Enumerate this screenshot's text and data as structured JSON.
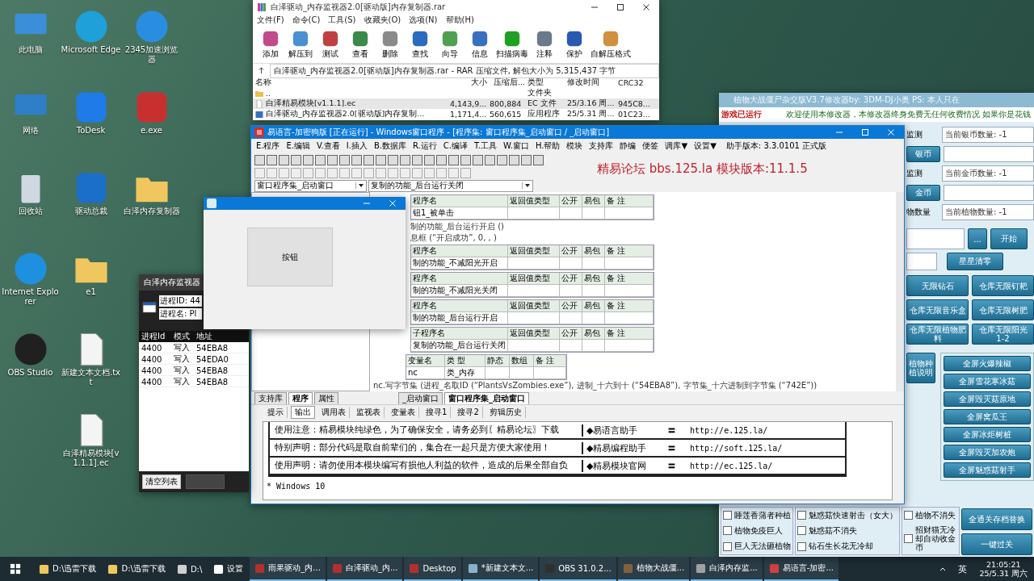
{
  "desktop": {
    "columns": [
      [
        {
          "label": "此电脑",
          "kind": "monitor",
          "color": "#3a8fd8"
        },
        {
          "label": "网络",
          "kind": "monitor",
          "color": "#2f7fc8"
        },
        {
          "label": "回收站",
          "kind": "bin",
          "color": "#cfd8e0"
        },
        {
          "label": "Internet Explorer",
          "kind": "circle",
          "color": "#1e90e0"
        },
        {
          "label": "OBS Studio",
          "kind": "circle",
          "color": "#202020"
        }
      ],
      [
        {
          "label": "Microsoft Edge",
          "kind": "circle",
          "color": "#1fa0d8"
        },
        {
          "label": "ToDesk",
          "kind": "app",
          "color": "#1f7be8"
        },
        {
          "label": "驱动总裁",
          "kind": "app",
          "color": "#1a6fc8"
        },
        {
          "label": "e1",
          "kind": "folder",
          "color": "#f0c75e"
        },
        {
          "label": "新建文本文档.txt",
          "kind": "doc",
          "color": "#f4f4f4"
        },
        {
          "label": "白泽精易模块[v1.1.1].ec",
          "kind": "doc",
          "color": "#f4f4f4"
        }
      ],
      [
        {
          "label": "2345加速浏览器",
          "kind": "circle",
          "color": "#2a8ee0"
        },
        {
          "label": "e.exe",
          "kind": "app",
          "color": "#c83030"
        },
        {
          "label": "白泽内存复制器",
          "kind": "folder",
          "color": "#f0c75e"
        }
      ]
    ]
  },
  "rar": {
    "title": "白泽驱动_内存监视器2.0[驱动版]内存复制器.rar",
    "menu": [
      "文件(F)",
      "命令(C)",
      "工具(S)",
      "收藏夹(O)",
      "选项(N)",
      "帮助(H)"
    ],
    "tools": [
      {
        "label": "添加",
        "color": "#c04a8a"
      },
      {
        "label": "解压到",
        "color": "#4a90d0"
      },
      {
        "label": "测试",
        "color": "#c04040"
      },
      {
        "label": "查看",
        "color": "#3a8a4a"
      },
      {
        "label": "删除",
        "color": "#8a8a8a"
      },
      {
        "label": "查找",
        "color": "#2a6ac0"
      },
      {
        "label": "向导",
        "color": "#50a050"
      },
      {
        "label": "信息",
        "color": "#3a70c0"
      },
      {
        "label": "扫描病毒",
        "color": "#20a020"
      },
      {
        "label": "注释",
        "color": "#6a7a8a"
      },
      {
        "label": "保护",
        "color": "#2a5ab0"
      },
      {
        "label": "自解压格式",
        "color": "#d09040"
      }
    ],
    "path": "白泽驱动_内存监视器2.0[驱动版]内存复制器.rar - RAR 压缩文件, 解包大小为 5,315,437 字节",
    "columns": [
      "名称",
      "大小",
      "压缩后...",
      "类型",
      "修改时间",
      "CRC32"
    ],
    "rows": [
      {
        "kind": "folder",
        "cells": [
          "..",
          "",
          "",
          "文件夹",
          "",
          ""
        ],
        "selected": false
      },
      {
        "kind": "file",
        "cells": [
          "白泽精易模块[v1.1.1].ec",
          "4,143,9...",
          "800,884",
          "EC 文件",
          "25/3.16 周...",
          "945C8..."
        ],
        "selected": true
      },
      {
        "kind": "exe",
        "cells": [
          "白泽驱动_内存监视器2.0[驱动版]内存复制...",
          "1,171,4...",
          "560,615",
          "应用程序",
          "25/5.31 周...",
          "01C23..."
        ],
        "selected": false
      }
    ]
  },
  "trainer": {
    "title": "植物大战僵尸杂交版V3.7修改器by: 3DM-DJ小奥 PS: 本人只在",
    "status": "游戏已运行",
    "welcome": "欢迎使用本修改器，本修改器终身免费无任何收费情况 如果你是花钱",
    "rows": [
      {
        "kind": "label",
        "label": "监测",
        "value": "当前银币数量: -1"
      },
      {
        "kind": "button",
        "label": "银币",
        "value": ""
      },
      {
        "kind": "label",
        "label": "监测",
        "value": "当前金币数量: -1"
      },
      {
        "kind": "button",
        "label": "金币",
        "value": ""
      },
      {
        "kind": "label",
        "label": "物数量",
        "value": "当前植物数量: -1"
      }
    ],
    "browse": "...",
    "start": "开始",
    "clear_stars": "星星清零",
    "buttons": [
      "无限钻石",
      "仓库无限钉耙",
      "仓库无限音乐盒",
      "仓库无限树肥",
      "仓库无限植物肥料",
      "仓库无限阳光 1-2"
    ],
    "plant_note": "植物种植说明",
    "screen_buttons": [
      "全屏火爆辣椒",
      "全屏雪花寒冰菇",
      "全屏毁灭菇原地",
      "全屏窝瓜王",
      "全屏冰炬树桩",
      "全屏毁灭加农炮",
      "全屏魅惑菇射手"
    ],
    "checks": [
      [
        {
          "label": "睡莲香蒲者种植",
          "checked": false
        },
        {
          "label": "植物免疫巨人",
          "checked": false
        },
        {
          "label": "巨人无法砸植物",
          "checked": false
        }
      ],
      [
        {
          "label": "魅惑菇快速射击（女大）",
          "checked": false
        },
        {
          "label": "魅惑菇不消失",
          "checked": false
        },
        {
          "label": "钻石生长花无冷却",
          "checked": false
        }
      ],
      [
        {
          "label": "植物不消失",
          "checked": false
        },
        {
          "label": "招财猫无冷却自动收金币",
          "checked": false
        }
      ]
    ],
    "bottom_buttons": [
      "全通关存档替换",
      "一键过关"
    ]
  },
  "ide": {
    "title": "易语言-加密狗版 [正在运行] - Windows窗口程序 - [程序集: 窗口程序集_启动窗口 / _启动窗口]",
    "menu": [
      "E.程序",
      "E.编辑",
      "V.查看",
      "I.插入",
      "B.数据库",
      "R.运行",
      "C.编译",
      "T.工具",
      "W.窗口",
      "H.帮助",
      "模块",
      "支持库",
      "静编",
      "便签",
      "调库▼",
      "设置▼"
    ],
    "version": "助手版本: 3.3.0101 正式版",
    "banner": "精易论坛 bbs.125.la 模块版本:11.1.5",
    "selectors": [
      "窗口程序集_启动窗口",
      "复制的功能_后台运行关闭"
    ],
    "code": [
      {
        "kind": "table",
        "header": [
          "程序名",
          "返回值类型",
          "公开",
          "易包",
          "备 注"
        ],
        "cells": [
          "钮1_被单击"
        ]
      },
      {
        "kind": "line",
        "text": "制的功能_后台运行开启 ()"
      },
      {
        "kind": "line",
        "text": "息框 (“开启成功”, 0, , )"
      },
      {
        "kind": "table",
        "header": [
          "程序名",
          "返回值类型",
          "公开",
          "易包",
          "备 注"
        ],
        "cells": [
          "制的功能_不减阳光开启"
        ]
      },
      {
        "kind": "table",
        "header": [
          "程序名",
          "返回值类型",
          "公开",
          "易包",
          "备 注"
        ],
        "cells": [
          "制的功能_不减阳光关闭"
        ]
      },
      {
        "kind": "table",
        "header": [
          "程序名",
          "返回值类型",
          "公开",
          "易包",
          "备 注"
        ],
        "cells": [
          "制的功能_后台运行开启"
        ]
      },
      {
        "kind": "table",
        "header": [
          "子程序名",
          "返回值类型",
          "公开",
          "易包",
          "备 注"
        ],
        "cells": [
          "复制的功能_后台运行关闭"
        ]
      },
      {
        "kind": "vars",
        "header": [
          "变量名",
          "类 型",
          "静态",
          "数组",
          "备 注"
        ],
        "cells": [
          "nc",
          "类_内存"
        ]
      },
      {
        "kind": "line",
        "text": "nc.写字节集 (进程_名取ID (“PlantsVsZombies.exe”), 进制_十六到十 (“54EBA8”), 字节集_十六进制到字节集 (“742E”))"
      }
    ],
    "panel_tabs": [
      {
        "label": "支持库",
        "selected": false
      },
      {
        "label": "程序",
        "selected": true
      },
      {
        "label": "属性",
        "selected": false
      }
    ],
    "editor_tabs": [
      {
        "label": "_启动窗口",
        "selected": false
      },
      {
        "label": "窗口程序集_启动窗口",
        "selected": true
      }
    ],
    "output_tabs": [
      {
        "label": "提示",
        "selected": false
      },
      {
        "label": "输出",
        "selected": true
      },
      {
        "label": "调用表",
        "selected": false
      },
      {
        "label": "监视表",
        "selected": false
      },
      {
        "label": "变量表",
        "selected": false
      },
      {
        "label": "搜寻1",
        "selected": false
      },
      {
        "label": "搜寻2",
        "selected": false
      },
      {
        "label": "剪辑历史",
        "selected": false
      }
    ],
    "output": [
      {
        "notice": "使用注意：精易模块纯绿色，为了确保安全，请务必到〖精易论坛〗下载",
        "site": "◆易语言助手",
        "eq": "〓",
        "url": "http://e.125.la/"
      },
      {
        "notice": "特别声明：部分代码是取自前辈们的，集合在一起只是方便大家使用！",
        "site": "◆精易编程助手",
        "eq": "〓",
        "url": "http://soft.125.la/"
      },
      {
        "notice": "使用声明：请勿使用本模块编写有损他人利益的软件，造成的后果全部自负",
        "site": "◆精易模块官网",
        "eq": "〓",
        "url": "http://ec.125.la/"
      }
    ],
    "os": "* Windows 10"
  },
  "form": {
    "button": "按钮"
  },
  "monitor": {
    "title": "白泽内存监视器",
    "fields": [
      "进程ID: 44",
      "进程名: Pl"
    ],
    "columns": [
      "进程Id",
      "模式",
      "地址"
    ],
    "rows": [
      [
        "4400",
        "写入",
        "54EBA8"
      ],
      [
        "4400",
        "写入",
        "54EDA0"
      ],
      [
        "4400",
        "写入",
        "54EBA8"
      ],
      [
        "4400",
        "写入",
        "54EBA8"
      ]
    ],
    "clear": "清空列表"
  },
  "taskbar": {
    "items": [
      {
        "label": "D:\\迅雷下载",
        "color": "#f0c75e",
        "active": false
      },
      {
        "label": "D:\\迅雷下载",
        "color": "#f0c75e",
        "active": false
      },
      {
        "label": "D:\\",
        "color": "#d0d0d0",
        "active": false
      },
      {
        "label": "设置",
        "color": "#ffffff",
        "active": false
      },
      {
        "label": "雨果驱动_内...",
        "color": "#b03030",
        "active": true
      },
      {
        "label": "白泽驱动_内...",
        "color": "#b03030",
        "active": true
      },
      {
        "label": "Desktop",
        "color": "#b03030",
        "active": true
      },
      {
        "label": "*新建文本文...",
        "color": "#8ab0d0",
        "active": true
      },
      {
        "label": "OBS 31.0.2...",
        "color": "#303030",
        "active": true
      },
      {
        "label": "植物大战僵...",
        "color": "#806040",
        "active": true
      },
      {
        "label": "白泽内存监...",
        "color": "#a0a0a0",
        "active": true
      },
      {
        "label": "易语言-加密...",
        "color": "#d04040",
        "active": true
      }
    ],
    "ime": "英",
    "time": "21:05:21",
    "date": "25/5.31 周六"
  }
}
